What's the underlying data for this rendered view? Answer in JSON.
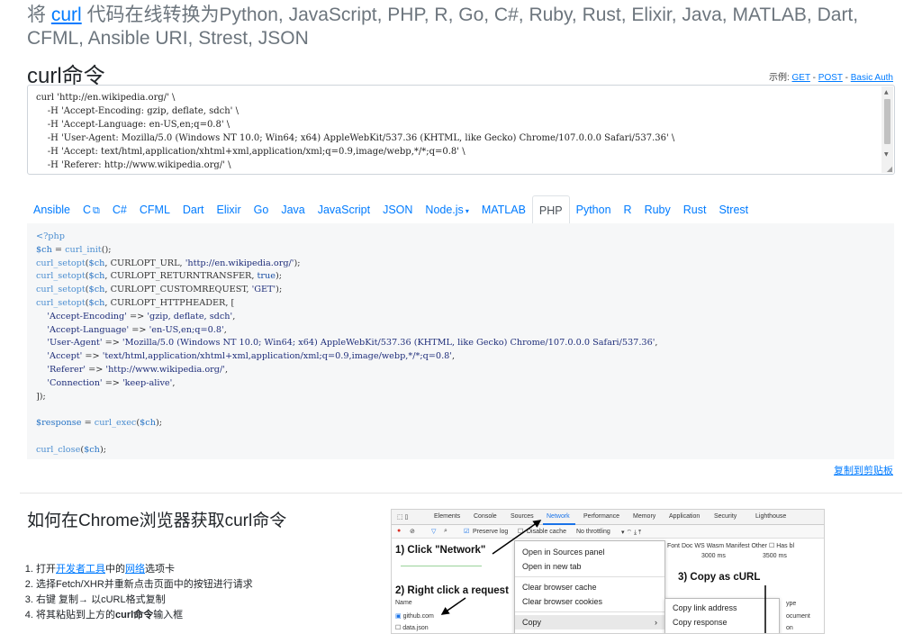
{
  "header": {
    "prefix": "将 ",
    "curl_link": "curl",
    "suffix": " 代码在线转换为Python, JavaScript, PHP, R, Go, C#, Ruby, Rust, Elixir, Java, MATLAB, Dart, CFML, Ansible URI, Strest, JSON"
  },
  "curl_section": {
    "title": "curl命令",
    "examples_label": "示例: ",
    "examples": [
      "GET",
      "POST",
      "Basic Auth"
    ],
    "separator": " - ",
    "command": "curl 'http://en.wikipedia.org/' \\\n    -H 'Accept-Encoding: gzip, deflate, sdch' \\\n    -H 'Accept-Language: en-US,en;q=0.8' \\\n    -H 'User-Agent: Mozilla/5.0 (Windows NT 10.0; Win64; x64) AppleWebKit/537.36 (KHTML, like Gecko) Chrome/107.0.0.0 Safari/537.36' \\\n    -H 'Accept: text/html,application/xhtml+xml,application/xml;q=0.9,image/webp,*/*;q=0.8' \\\n    -H 'Referer: http://www.wikipedia.org/' \\\n    -H 'Connection: keep-alive' --compressed"
  },
  "tabs": [
    {
      "label": "Ansible",
      "name": "ansible"
    },
    {
      "label": "C",
      "name": "c",
      "external": true
    },
    {
      "label": "C#",
      "name": "csharp"
    },
    {
      "label": "CFML",
      "name": "cfml"
    },
    {
      "label": "Dart",
      "name": "dart"
    },
    {
      "label": "Elixir",
      "name": "elixir"
    },
    {
      "label": "Go",
      "name": "go"
    },
    {
      "label": "Java",
      "name": "java"
    },
    {
      "label": "JavaScript",
      "name": "javascript"
    },
    {
      "label": "JSON",
      "name": "json"
    },
    {
      "label": "Node.js",
      "name": "nodejs",
      "dropdown": true
    },
    {
      "label": "MATLAB",
      "name": "matlab"
    },
    {
      "label": "PHP",
      "name": "php",
      "active": true
    },
    {
      "label": "Python",
      "name": "python"
    },
    {
      "label": "R",
      "name": "r"
    },
    {
      "label": "Ruby",
      "name": "ruby"
    },
    {
      "label": "Rust",
      "name": "rust"
    },
    {
      "label": "Strest",
      "name": "strest"
    }
  ],
  "code": {
    "open_tag": "<?php",
    "init": [
      "$ch",
      " = ",
      "curl_init",
      "();"
    ],
    "setopts": [
      {
        "opt": "CURLOPT_URL",
        "val": "'http://en.wikipedia.org/'",
        "kind": "str"
      },
      {
        "opt": "CURLOPT_RETURNTRANSFER",
        "val": "true",
        "kind": "kw"
      },
      {
        "opt": "CURLOPT_CUSTOMREQUEST",
        "val": "'GET'",
        "kind": "str"
      }
    ],
    "header_opt": "CURLOPT_HTTPHEADER",
    "headers": [
      {
        "k": "'Accept-Encoding'",
        "v": "'gzip, deflate, sdch'"
      },
      {
        "k": "'Accept-Language'",
        "v": "'en-US,en;q=0.8'"
      },
      {
        "k": "'User-Agent'",
        "v": "'Mozilla/5.0 (Windows NT 10.0; Win64; x64) AppleWebKit/537.36 (KHTML, like Gecko) Chrome/107.0.0.0 Safari/537.36'"
      },
      {
        "k": "'Accept'",
        "v": "'text/html,application/xhtml+xml,application/xml;q=0.9,image/webp,*/*;q=0.8'"
      },
      {
        "k": "'Referer'",
        "v": "'http://www.wikipedia.org/'"
      },
      {
        "k": "'Connection'",
        "v": "'keep-alive'"
      }
    ],
    "response_var": "$response",
    "exec_fn": "curl_exec",
    "close_fn": "curl_close"
  },
  "copy_label": "复制到剪贴板",
  "howto": {
    "title": "如何在Chrome浏览器获取curl命令",
    "step1_a": "打开",
    "step1_link1": "开发者工具",
    "step1_b": "中的",
    "step1_link2": "网络",
    "step1_c": "选项卡",
    "step2": "选择Fetch/XHR并重新点击页面中的按钮进行请求",
    "step3": "右键 复制→ 以cURL格式复制",
    "step4_a": "将其粘贴到上方的",
    "step4_bold": "curl命令",
    "step4_b": "输入框"
  },
  "devtools": {
    "tabs": [
      "Elements",
      "Console",
      "Sources",
      "Network",
      "Performance",
      "Memory",
      "Application",
      "Security",
      "Lighthouse"
    ],
    "preserve_log": "Preserve log",
    "disable_cache": "Disable cache",
    "throttling": "No throttling",
    "filter_cols": "Font  Doc  WS  Wasm  Manifest  Other",
    "has_blocked": "Has bl",
    "ann1": "1) Click \"Network\"",
    "ann2": "2) Right click a request",
    "ann3": "3) Copy as cURL",
    "menu1": [
      "Open in Sources panel",
      "Open in new tab",
      "Clear browser cache",
      "Clear browser cookies",
      "Copy"
    ],
    "menu2": [
      "Copy link address",
      "Copy response"
    ],
    "name_header": "Name",
    "rows": [
      "github.com",
      "data.json"
    ],
    "side_labels": [
      "ype",
      "ocument",
      "on"
    ],
    "timings": [
      "3000 ms",
      "3500 ms"
    ]
  }
}
